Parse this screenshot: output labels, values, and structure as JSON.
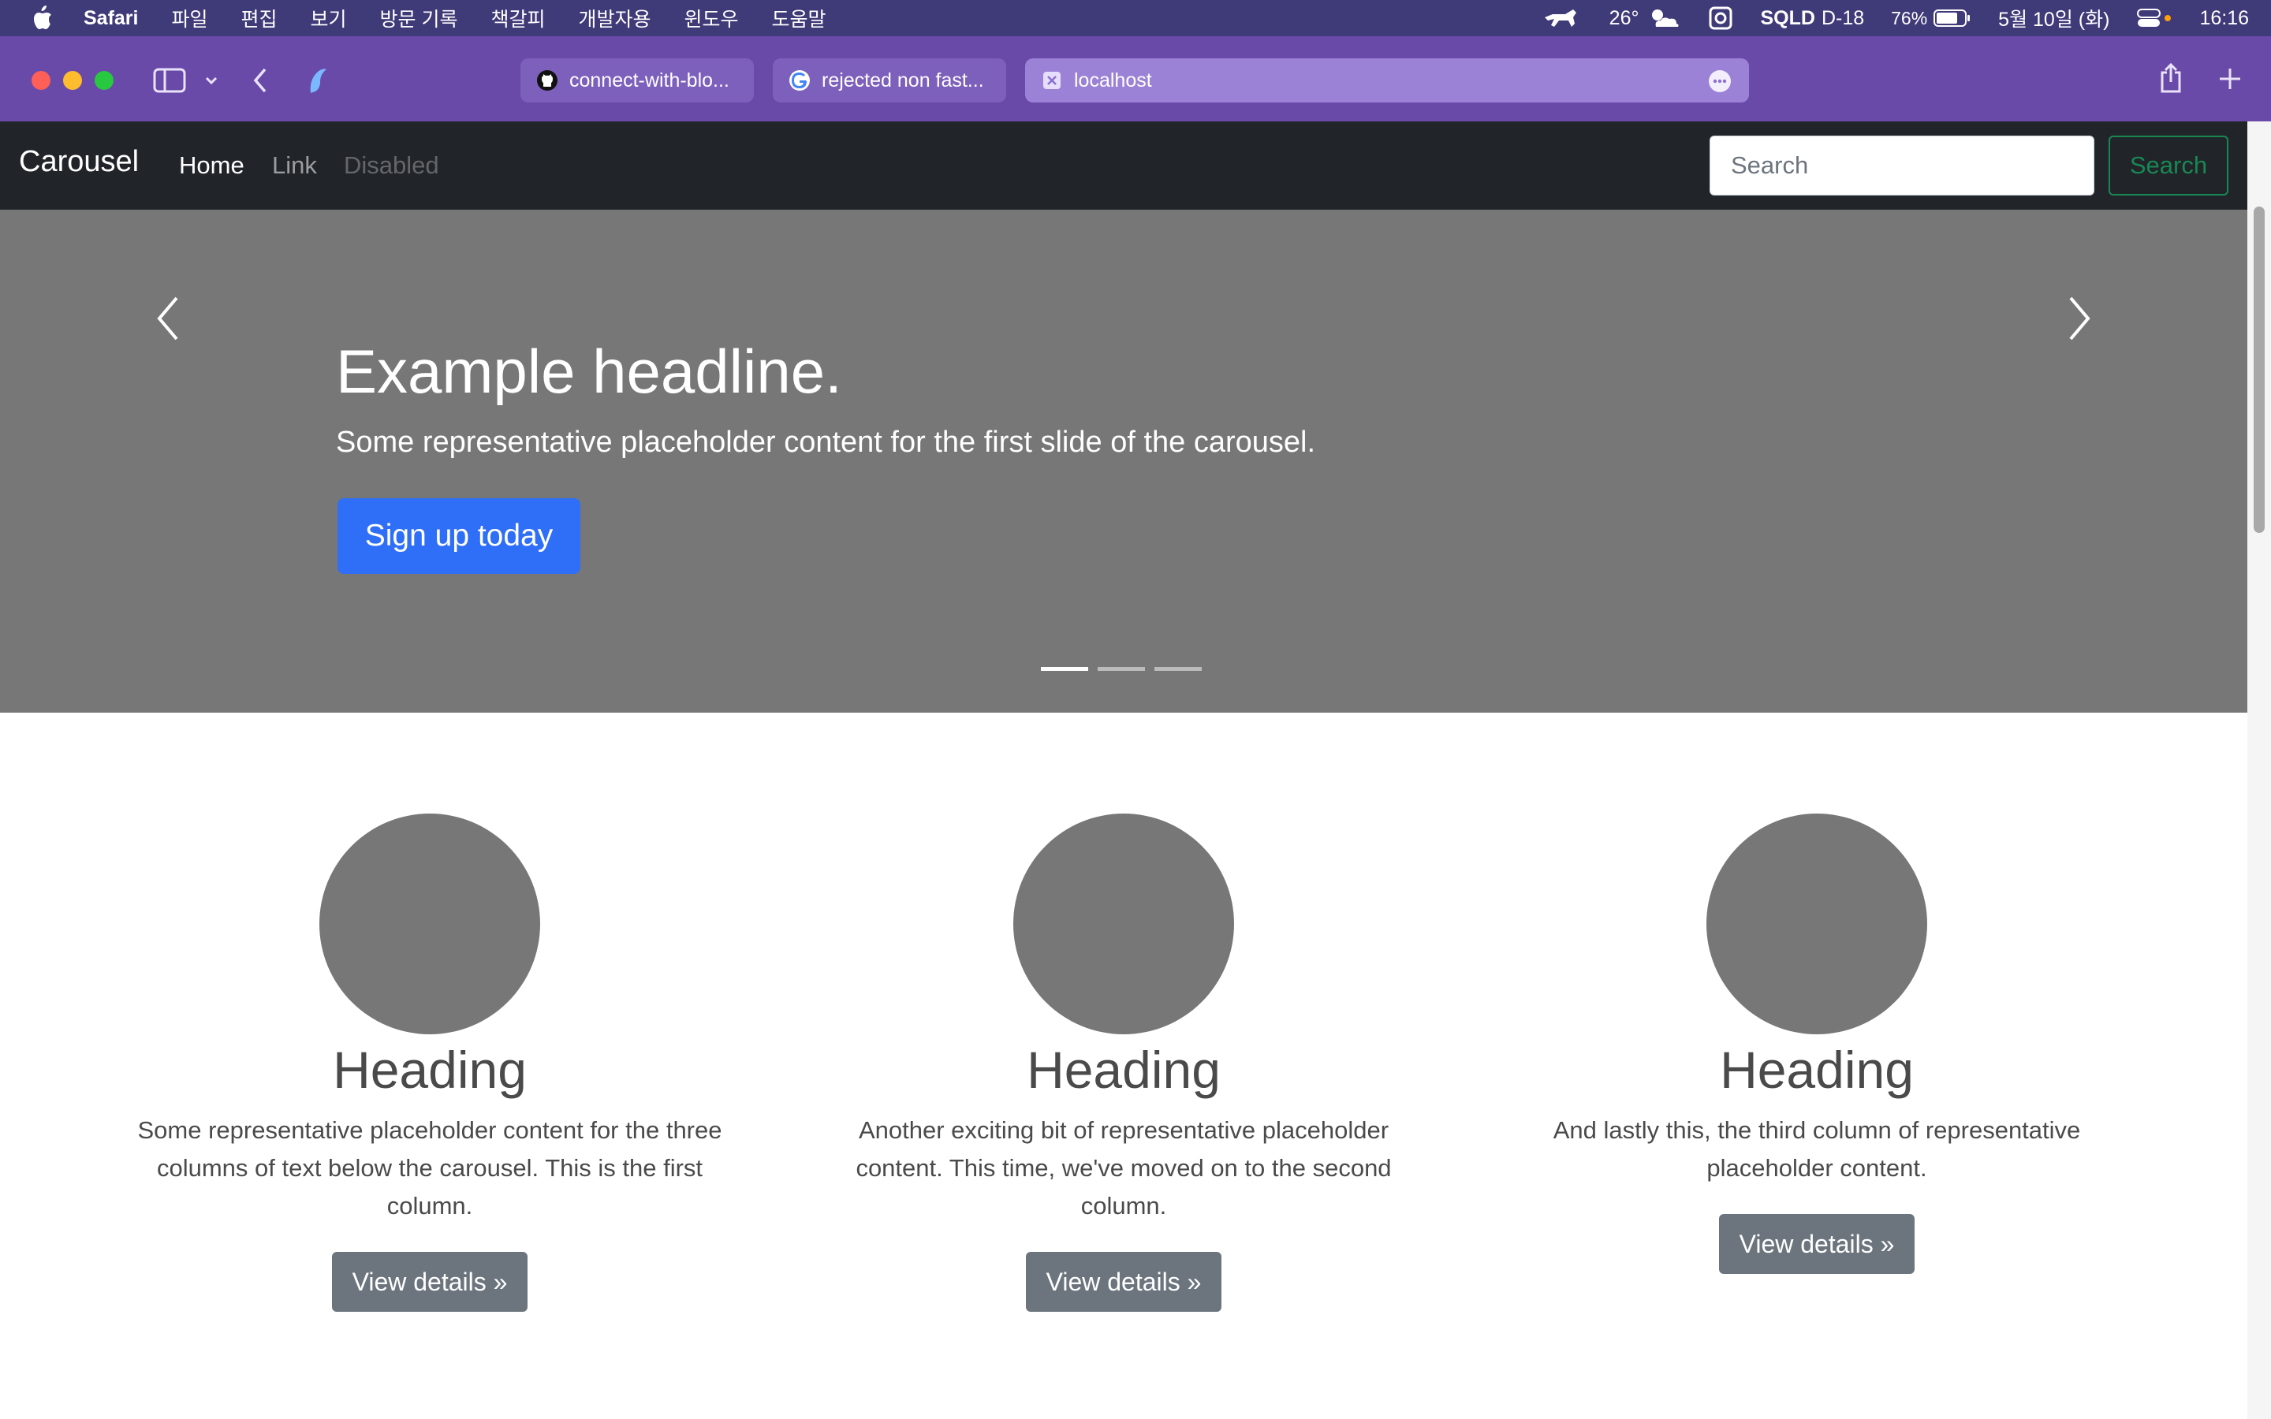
{
  "menubar": {
    "app_name": "Safari",
    "items": [
      "파일",
      "편집",
      "보기",
      "방문 기록",
      "책갈피",
      "개발자용",
      "윈도우",
      "도움말"
    ],
    "weather": "26°",
    "sqld": "SQLD",
    "dday": "D-18",
    "battery": "76%",
    "date": "5월 10일 (화)",
    "time": "16:16"
  },
  "browser": {
    "tabs": [
      {
        "title": "connect-with-blo...",
        "icon": "github-icon"
      },
      {
        "title": "rejected non fast...",
        "icon": "google-icon"
      },
      {
        "title": "localhost",
        "icon": "close-icon"
      }
    ]
  },
  "navbar": {
    "brand": "Carousel",
    "links": [
      "Home",
      "Link",
      "Disabled"
    ],
    "search_placeholder": "Search",
    "search_button": "Search"
  },
  "carousel": {
    "headline": "Example headline.",
    "lead": "Some representative placeholder content for the first slide of the carousel.",
    "cta": "Sign up today",
    "slide_count": 3,
    "active_slide": 1
  },
  "columns": [
    {
      "heading": "Heading",
      "text": "Some representative placeholder content for the three columns of text below the carousel. This is the first column.",
      "button": "View details »"
    },
    {
      "heading": "Heading",
      "text": "Another exciting bit of representative placeholder content. This time, we've moved on to the second column.",
      "button": "View details »"
    },
    {
      "heading": "Heading",
      "text": "And lastly this, the third column of representative placeholder content.",
      "button": "View details »"
    }
  ],
  "colors": {
    "menubar": "#3f3a78",
    "toolbar": "#6a4aa8",
    "navbar": "#212529",
    "carousel": "#777777",
    "primary": "#2f6ef6",
    "success": "#198754",
    "secondary": "#6c757d"
  }
}
